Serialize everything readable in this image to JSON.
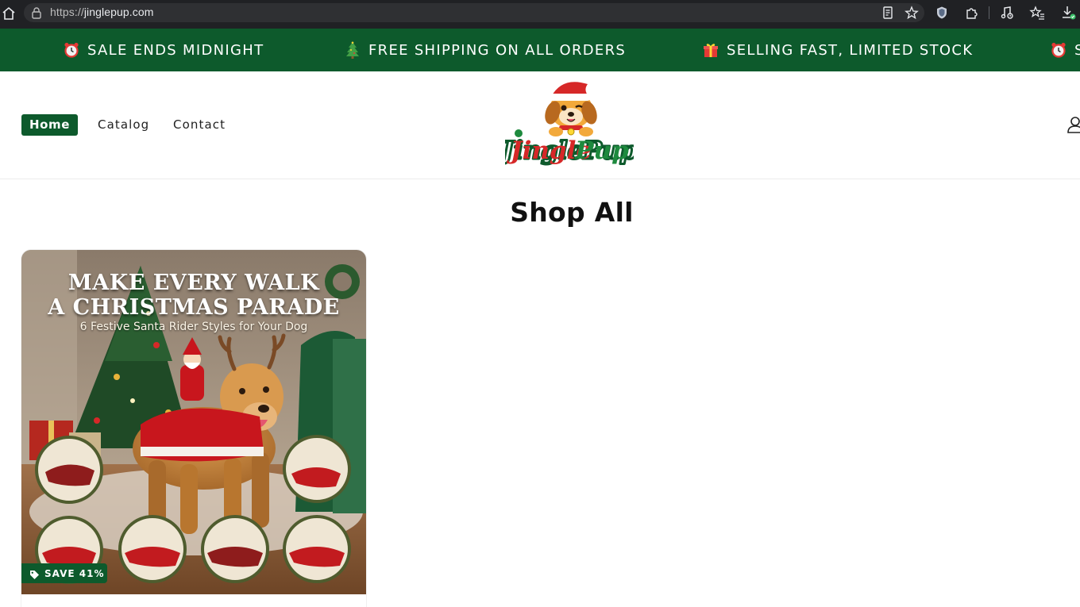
{
  "browser": {
    "url_scheme": "https://",
    "url_host": "jinglepup.com"
  },
  "announcement": {
    "items": [
      {
        "icon": "alarm-clock-icon",
        "text": "SALE ENDS MIDNIGHT"
      },
      {
        "icon": "christmas-tree-icon",
        "text": "FREE SHIPPING ON ALL ORDERS"
      },
      {
        "icon": "gift-icon",
        "text": "SELLING FAST, LIMITED STOCK"
      },
      {
        "icon": "alarm-clock-icon",
        "text": "S"
      }
    ]
  },
  "header": {
    "nav": {
      "home": "Home",
      "catalog": "Catalog",
      "contact": "Contact"
    },
    "logo_text": "JinglePup"
  },
  "main": {
    "title": "Shop All",
    "products": [
      {
        "image_headline_1": "MAKE EVERY WALK",
        "image_headline_2": "A CHRISTMAS PARADE",
        "image_subheadline": "6 Festive Santa Rider Styles for Your Dog",
        "badge": "SAVE 41%"
      }
    ]
  },
  "colors": {
    "brand_green": "#0d5a2c",
    "brand_red": "#d62828",
    "browser_bg": "#202124"
  }
}
